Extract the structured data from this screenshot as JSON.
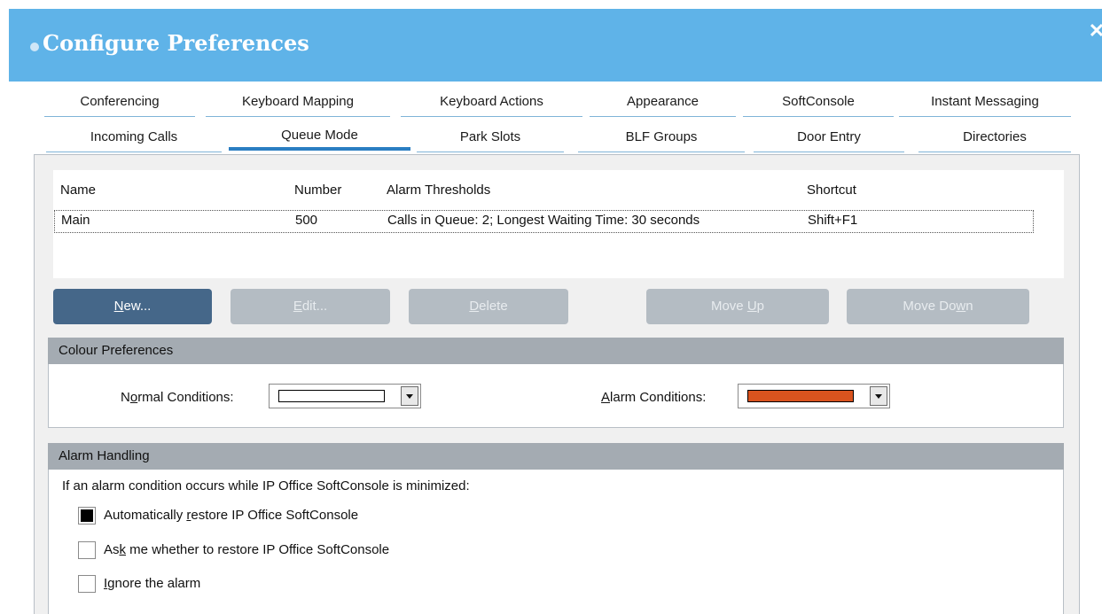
{
  "window": {
    "title": "Configure Preferences",
    "close_label": "✕"
  },
  "tabs": {
    "row1": [
      "Conferencing",
      "Keyboard Mapping",
      "Keyboard Actions",
      "Appearance",
      "SoftConsole",
      "Instant Messaging"
    ],
    "row2": [
      "Incoming Calls",
      "Queue Mode",
      "Park Slots",
      "BLF Groups",
      "Door Entry",
      "Directories"
    ],
    "active": "Queue Mode"
  },
  "queue_table": {
    "headers": {
      "name": "Name",
      "number": "Number",
      "thresholds": "Alarm Thresholds",
      "shortcut": "Shortcut"
    },
    "rows": [
      {
        "name": "Main",
        "number": "500",
        "thresholds": "Calls in Queue: 2; Longest Waiting Time: 30 seconds",
        "shortcut": "Shift+F1"
      }
    ]
  },
  "buttons": {
    "new": {
      "underline": "N",
      "rest": "ew..."
    },
    "edit": {
      "underline": "E",
      "rest": "dit..."
    },
    "delete": {
      "underline": "D",
      "rest": "elete"
    },
    "move_up": {
      "pre": "Move ",
      "underline": "U",
      "post": "p"
    },
    "move_down": {
      "pre": "Move Do",
      "underline": "w",
      "post": "n"
    }
  },
  "colour_prefs": {
    "header": "Colour Preferences",
    "normal": {
      "pre": "N",
      "underline": "o",
      "post": "rmal Conditions:",
      "color": "#ffffff"
    },
    "alarm": {
      "pre": "",
      "underline": "A",
      "post": "larm Conditions:",
      "color": "#d9531e"
    }
  },
  "alarm_handling": {
    "header": "Alarm Handling",
    "intro": "If an alarm condition occurs while IP Office SoftConsole is minimized:",
    "options": [
      {
        "pre": "Automatically ",
        "underline": "r",
        "post": "estore IP Office SoftConsole",
        "selected": true
      },
      {
        "pre": "As",
        "underline": "k",
        "post": " me whether to restore IP Office SoftConsole",
        "selected": false
      },
      {
        "pre": "",
        "underline": "I",
        "post": "gnore the alarm",
        "selected": false
      }
    ]
  }
}
